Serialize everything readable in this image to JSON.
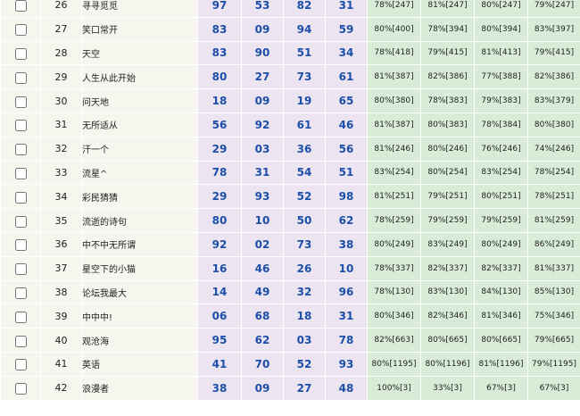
{
  "rows": [
    {
      "idx": "26",
      "name": "寻寻觅觅",
      "nums": [
        "97",
        "53",
        "82",
        "31"
      ],
      "pcts": [
        "78%[247]",
        "81%[247]",
        "80%[247]",
        "79%[247]"
      ]
    },
    {
      "idx": "27",
      "name": "笑口常开",
      "nums": [
        "83",
        "09",
        "94",
        "59"
      ],
      "pcts": [
        "80%[400]",
        "78%[394]",
        "80%[394]",
        "83%[397]"
      ]
    },
    {
      "idx": "28",
      "name": "天空",
      "nums": [
        "83",
        "90",
        "51",
        "34"
      ],
      "pcts": [
        "78%[418]",
        "79%[415]",
        "81%[413]",
        "79%[415]"
      ]
    },
    {
      "idx": "29",
      "name": "人生从此开始",
      "nums": [
        "80",
        "27",
        "73",
        "61"
      ],
      "pcts": [
        "81%[387]",
        "82%[386]",
        "77%[388]",
        "82%[386]"
      ]
    },
    {
      "idx": "30",
      "name": "问天地",
      "nums": [
        "18",
        "09",
        "19",
        "65"
      ],
      "pcts": [
        "80%[380]",
        "78%[383]",
        "79%[383]",
        "83%[379]"
      ]
    },
    {
      "idx": "31",
      "name": "无所适从",
      "nums": [
        "56",
        "92",
        "61",
        "46"
      ],
      "pcts": [
        "81%[387]",
        "80%[383]",
        "78%[384]",
        "80%[380]"
      ]
    },
    {
      "idx": "32",
      "name": "汗一个",
      "nums": [
        "29",
        "03",
        "36",
        "56"
      ],
      "pcts": [
        "81%[246]",
        "80%[246]",
        "76%[246]",
        "74%[246]"
      ]
    },
    {
      "idx": "33",
      "name": "流星^",
      "nums": [
        "78",
        "31",
        "54",
        "51"
      ],
      "pcts": [
        "83%[254]",
        "80%[254]",
        "83%[254]",
        "78%[254]"
      ]
    },
    {
      "idx": "34",
      "name": "彩民猜猜",
      "nums": [
        "29",
        "93",
        "52",
        "98"
      ],
      "pcts": [
        "81%[251]",
        "79%[251]",
        "80%[251]",
        "78%[251]"
      ]
    },
    {
      "idx": "35",
      "name": "流逝的诗句",
      "nums": [
        "80",
        "10",
        "50",
        "62"
      ],
      "pcts": [
        "78%[259]",
        "79%[259]",
        "79%[259]",
        "81%[259]"
      ]
    },
    {
      "idx": "36",
      "name": "中不中无所谓",
      "nums": [
        "92",
        "02",
        "73",
        "38"
      ],
      "pcts": [
        "80%[249]",
        "83%[249]",
        "80%[249]",
        "86%[249]"
      ]
    },
    {
      "idx": "37",
      "name": "星空下的小猫",
      "nums": [
        "16",
        "46",
        "26",
        "10"
      ],
      "pcts": [
        "78%[337]",
        "82%[337]",
        "82%[337]",
        "81%[337]"
      ]
    },
    {
      "idx": "38",
      "name": "论坛我最大",
      "nums": [
        "14",
        "49",
        "32",
        "96"
      ],
      "pcts": [
        "78%[130]",
        "83%[130]",
        "84%[130]",
        "85%[130]"
      ]
    },
    {
      "idx": "39",
      "name": "中中中!",
      "nums": [
        "06",
        "68",
        "18",
        "31"
      ],
      "pcts": [
        "80%[346]",
        "82%[346]",
        "81%[346]",
        "75%[346]"
      ]
    },
    {
      "idx": "40",
      "name": "观沧海",
      "nums": [
        "95",
        "62",
        "03",
        "78"
      ],
      "pcts": [
        "82%[663]",
        "80%[665]",
        "80%[665]",
        "79%[665]"
      ]
    },
    {
      "idx": "41",
      "name": "英语",
      "nums": [
        "41",
        "70",
        "52",
        "93"
      ],
      "pcts": [
        "80%[1195]",
        "80%[1196]",
        "81%[1196]",
        "79%[1195]"
      ]
    },
    {
      "idx": "42",
      "name": "浪漫者",
      "nums": [
        "38",
        "09",
        "27",
        "48"
      ],
      "pcts": [
        "100%[3]",
        "33%[3]",
        "67%[3]",
        "67%[3]"
      ]
    }
  ]
}
